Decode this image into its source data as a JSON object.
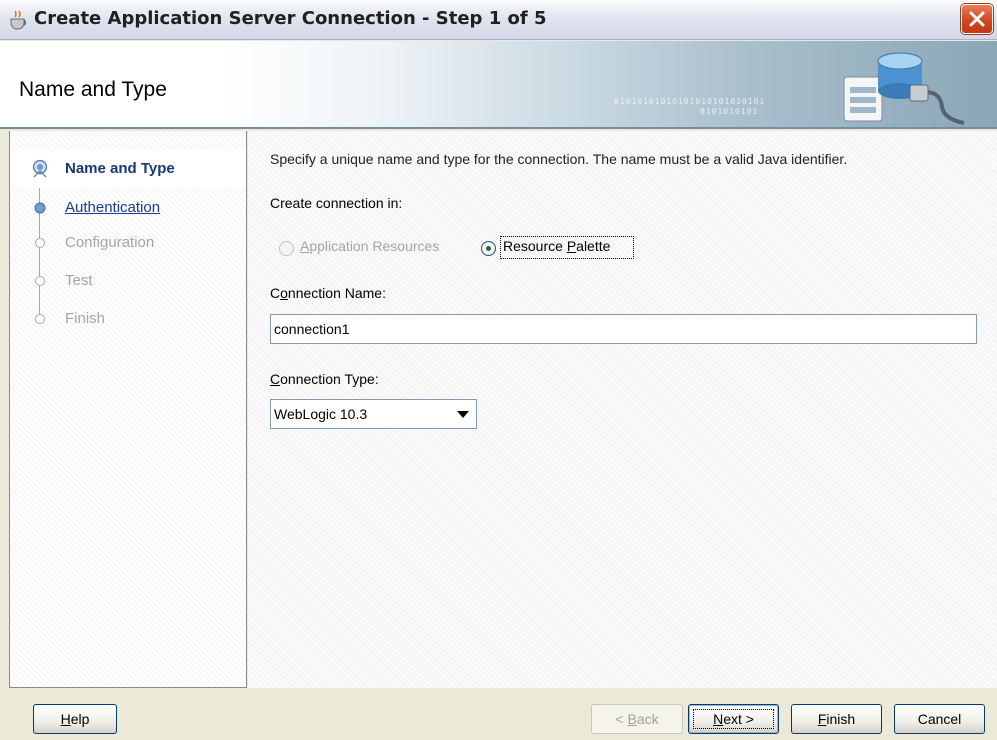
{
  "window": {
    "title": "Create Application Server Connection - Step 1 of 5",
    "icon": "java-cup-icon",
    "close_icon": "close-icon"
  },
  "header": {
    "title": "Name and Type",
    "decoration_text": "01010101010101010101010101",
    "decoration_text_2": "0101010101"
  },
  "nav": {
    "items": [
      {
        "label": "Name and Type",
        "state": "current"
      },
      {
        "label": "Authentication",
        "state": "link"
      },
      {
        "label": "Configuration",
        "state": "disabled"
      },
      {
        "label": "Test",
        "state": "disabled"
      },
      {
        "label": "Finish",
        "state": "disabled"
      }
    ]
  },
  "main": {
    "description": "Specify a unique name and type for the connection. The name must be a valid Java identifier.",
    "create_in_label": "Create connection in:",
    "radio_app_resources": {
      "prefix": "",
      "mnemonic": "A",
      "suffix": "pplication Resources",
      "selected": false,
      "enabled": false
    },
    "radio_resource_palette": {
      "prefix": "Resource ",
      "mnemonic": "P",
      "suffix": "alette",
      "selected": true,
      "enabled": true
    },
    "connection_name_label": {
      "prefix": "C",
      "mnemonic": "o",
      "suffix": "nnection Name:"
    },
    "connection_name_value": "connection1",
    "connection_type_label": {
      "prefix": "",
      "mnemonic": "C",
      "suffix": "onnection Type:"
    },
    "connection_type_value": "WebLogic 10.3"
  },
  "buttons": {
    "help": {
      "mnemonic": "H",
      "suffix": "elp"
    },
    "back": {
      "prefix": "< ",
      "mnemonic": "B",
      "suffix": "ack",
      "enabled": false
    },
    "next": {
      "prefix": "",
      "mnemonic": "N",
      "suffix": "ext >"
    },
    "finish": {
      "prefix": "",
      "mnemonic": "F",
      "suffix": "inish"
    },
    "cancel": {
      "label": "Cancel"
    }
  },
  "colors": {
    "title_bar": "#d3d7e6",
    "accent_link": "#1a3b9c",
    "active_step": "#16387a",
    "close_button": "#d4461f"
  }
}
